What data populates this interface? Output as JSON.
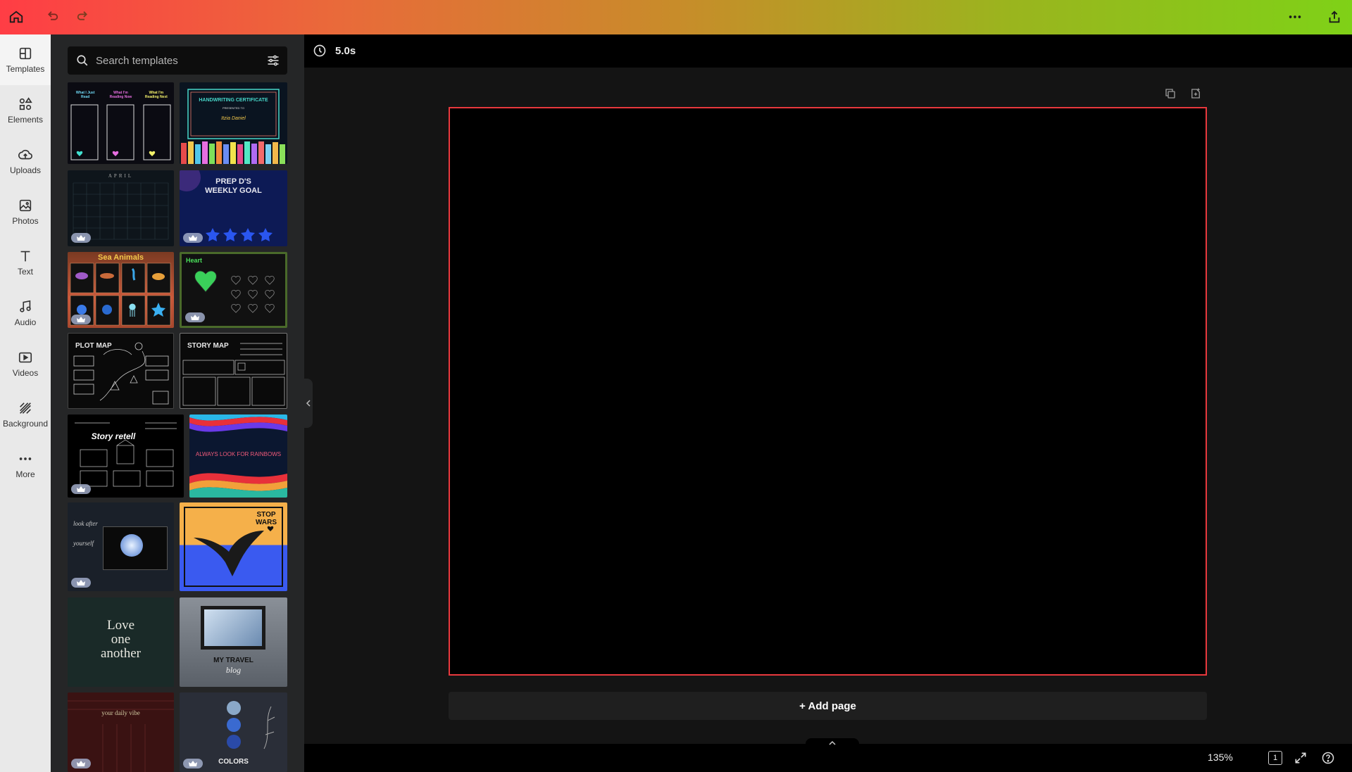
{
  "topbar": {
    "icons": [
      "home-icon",
      "undo-icon",
      "redo-icon",
      "more-icon",
      "share-icon"
    ]
  },
  "rail": {
    "items": [
      {
        "label": "Templates",
        "icon": "templates-icon"
      },
      {
        "label": "Elements",
        "icon": "elements-icon"
      },
      {
        "label": "Uploads",
        "icon": "uploads-icon"
      },
      {
        "label": "Photos",
        "icon": "photos-icon"
      },
      {
        "label": "Text",
        "icon": "text-icon"
      },
      {
        "label": "Audio",
        "icon": "audio-icon"
      },
      {
        "label": "Videos",
        "icon": "videos-icon"
      },
      {
        "label": "Background",
        "icon": "background-icon"
      },
      {
        "label": "More",
        "icon": "more-icon"
      }
    ]
  },
  "search": {
    "placeholder": "Search templates"
  },
  "templates": {
    "t1": {
      "col1": "What I Just Read",
      "col2": "What I'm Reading Now",
      "col3": "What I'm Reading Next"
    },
    "t2": {
      "title": "HANDWRITING CERTIFICATE",
      "sub": "PRESENTED TO",
      "name": "Itzia Daniel"
    },
    "t3": {
      "title": "APRIL"
    },
    "t4": {
      "title": "PREP D'S WEEKLY GOAL"
    },
    "t5": {
      "title": "Sea Animals"
    },
    "t6": {
      "title": "Heart"
    },
    "t7": {
      "title": "PLOT MAP"
    },
    "t8": {
      "title": "STORY MAP"
    },
    "t9": {
      "title": "Story retell"
    },
    "t10": {
      "title": "ALWAYS LOOK FOR RAINBOWS"
    },
    "t11": {
      "title": "look after yourself"
    },
    "t12": {
      "title": "STOP WARS"
    },
    "t13": {
      "line1": "Love",
      "line2": "one",
      "line3": "another"
    },
    "t14": {
      "title": "MY TRAVEL",
      "sub": "blog"
    },
    "t15": {
      "title": "your daily vibe"
    },
    "t16": {
      "title": "COLORS"
    }
  },
  "subbar": {
    "duration": "5.0s"
  },
  "canvas": {
    "add_page": "+ Add page"
  },
  "footer": {
    "zoom": "135%",
    "page_count": "1"
  },
  "colors": {
    "accent_border": "#e8383d"
  }
}
